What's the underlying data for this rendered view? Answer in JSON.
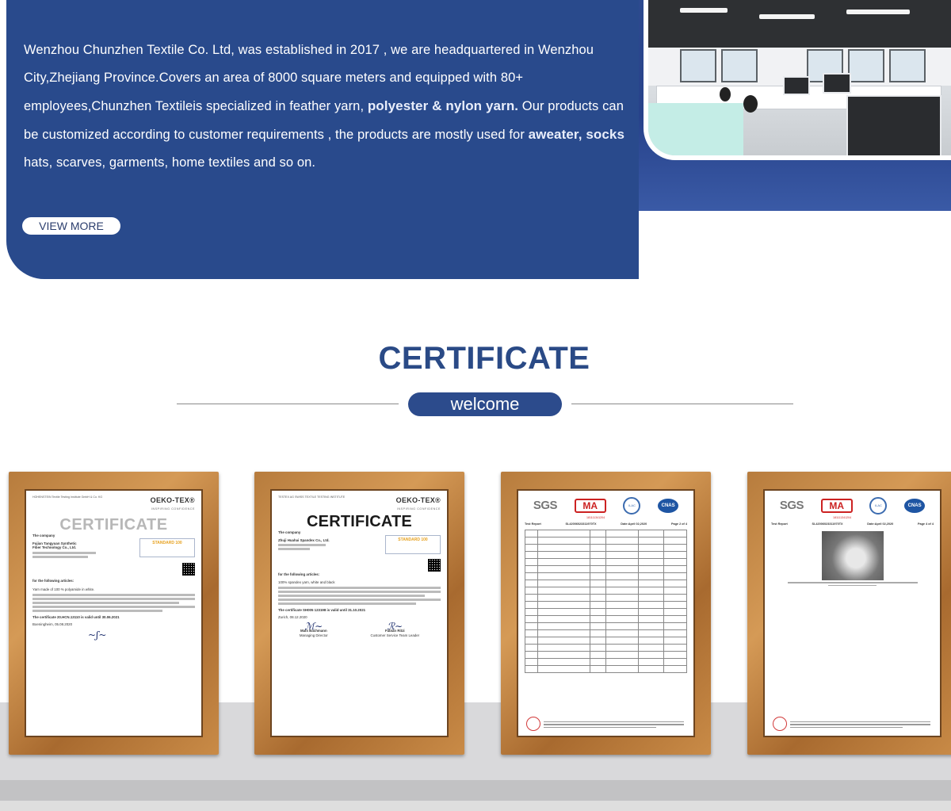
{
  "about": {
    "line1": "Wenzhou Chunzhen Textile Co. Ltd, was established in 2017 , we are headquartered in Wenzhou",
    "line2": "City,Zhejiang Province.Covers an area of 8000 square meters and equipped with 80+",
    "line3_start": "employees,Chunzhen Textileis specialized in  feather yarn, ",
    "line3_highlight": "polyester & nylon yarn.",
    "line3_end": " Our products can",
    "line4_start": "be customized according to customer requirements , the products are mostly used for ",
    "line4_highlight": " aweater, socks",
    "line5": "hats, scarves, garments, home textiles and so on.",
    "view_more": "VIEW MORE"
  },
  "certificates": {
    "title": "CERTIFICATE",
    "subtitle": "welcome"
  },
  "cert1": {
    "brand": "OEKO-TEX®",
    "brand_sub": "INSPIRING CONFIDENCE",
    "heading": "CERTIFICATE",
    "company_label": "The company",
    "company_name": "Fujian Tangyuan Synthetic",
    "company_name2": "Fiber Technology Co., Ltd.",
    "standard": "STANDARD 100",
    "articles_label": "for the following articles:",
    "articles": "Yarn made of 100 % polyamide in white.",
    "valid": "The certificate 20.HCN.13110 is valid until 30.06.2021",
    "place_date": "Boeningheim, 05.08.2020"
  },
  "cert2": {
    "brand": "OEKO-TEX®",
    "brand_sub": "INSPIRING CONFIDENCE",
    "heading": "CERTIFICATE",
    "company_label": "The company",
    "company_name": "Zhuji Huahai Spandex Co., Ltd.",
    "standard": "STANDARD 100",
    "articles_label": "for the following articles:",
    "articles": "100% spandex yarn, white and black",
    "valid": "The certificate SH005 123198 is valid until 31.10.2021",
    "place_date": "Zurich, 08.12.2020",
    "signer1": "Mats Bachmann",
    "signer1_role": "Managing Director",
    "signer2": "Fabian Ritzi",
    "signer2_role": "Customer Service Team Leader"
  },
  "cert3": {
    "sgs": "SGS",
    "ma": "MA",
    "ma_number": "181111341204",
    "cnas": "CNAS",
    "test_report": "Test Report",
    "report_no": "SL42006023311970TX",
    "date": "Date:April 02,2020",
    "page": "Page 2 of 4"
  },
  "cert4": {
    "sgs": "SGS",
    "ma": "MA",
    "ma_number": "181111341204",
    "cnas": "CNAS",
    "test_report": "Test Report",
    "report_no": "SL42006023311970TX",
    "date": "Date:April 02,2020",
    "page": "Page 4 of 4"
  },
  "colors": {
    "brand_blue": "#294a8c",
    "title_blue": "#2a4a86",
    "frame_wood": "#c98b47"
  }
}
